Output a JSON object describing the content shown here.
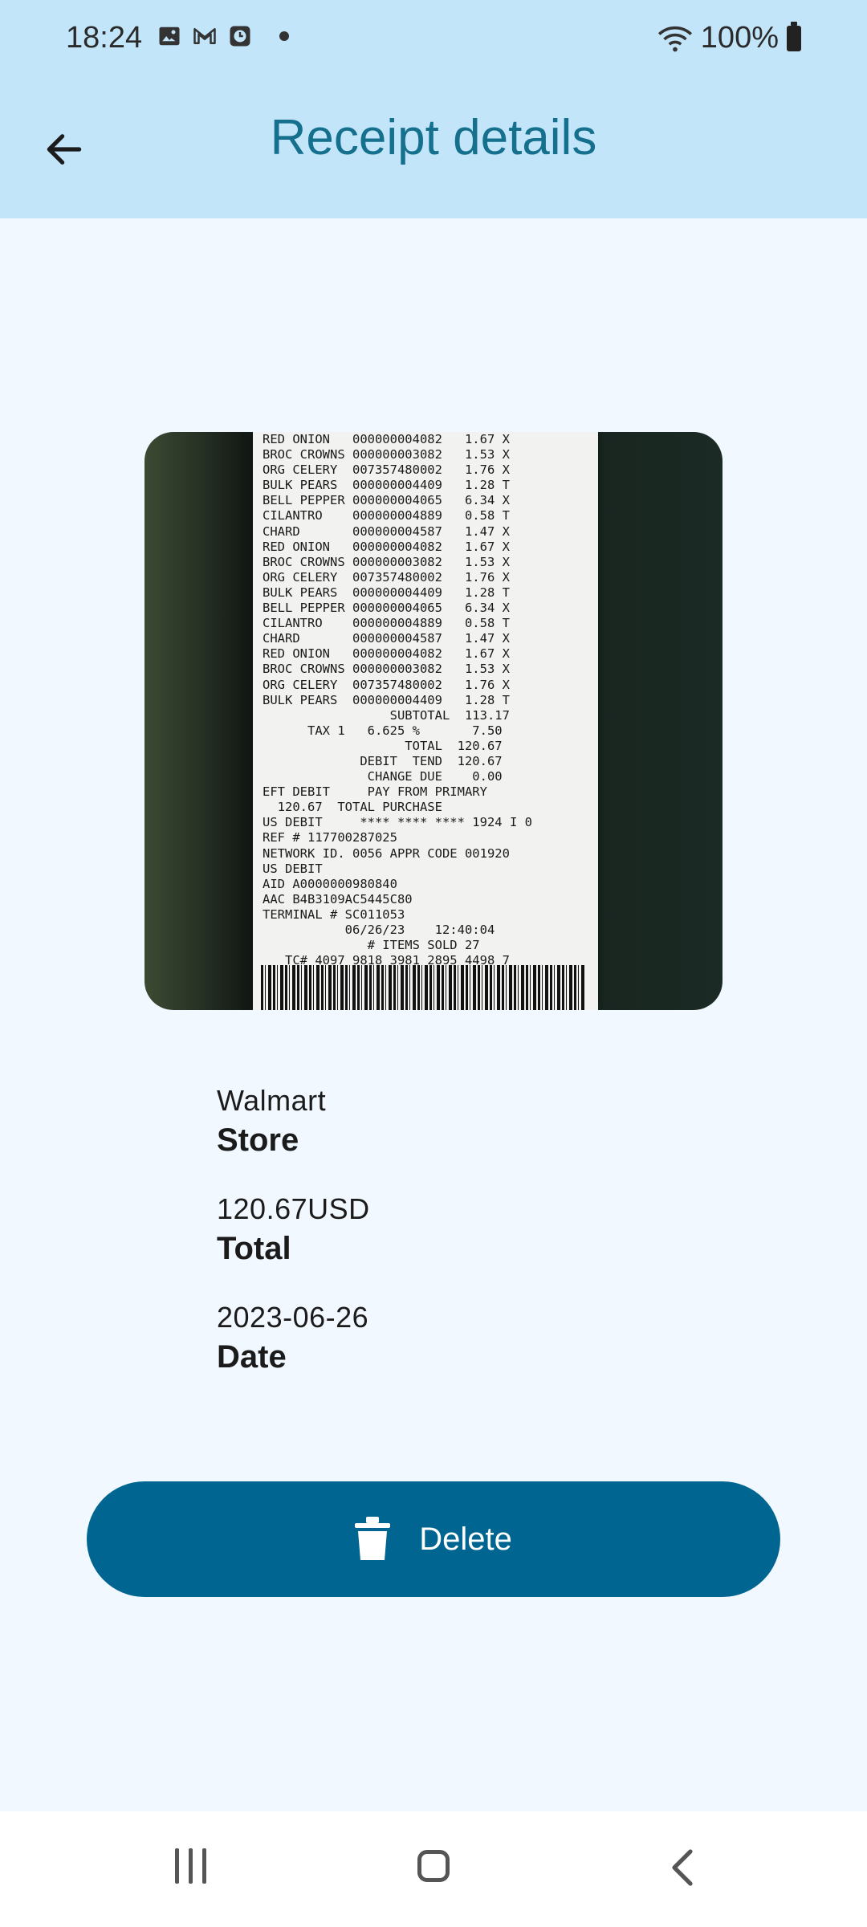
{
  "status_bar": {
    "time": "18:24",
    "battery": "100%",
    "icons": [
      "image-icon",
      "gmail-icon",
      "clock-app-icon",
      "notification-dot",
      "wifi-icon",
      "battery-icon"
    ]
  },
  "header": {
    "title": "Receipt details",
    "back_icon": "arrow-left-icon"
  },
  "receipt_image": {
    "lines": [
      "RED ONION   000000004082   1.67 X",
      "BROC CROWNS 000000003082   1.53 X",
      "ORG CELERY  007357480002   1.76 X",
      "BULK PEARS  000000004409   1.28 T",
      "BELL PEPPER 000000004065   6.34 X",
      "CILANTRO    000000004889   0.58 T",
      "CHARD       000000004587   1.47 X",
      "RED ONION   000000004082   1.67 X",
      "BROC CROWNS 000000003082   1.53 X",
      "ORG CELERY  007357480002   1.76 X",
      "BULK PEARS  000000004409   1.28 T",
      "BELL PEPPER 000000004065   6.34 X",
      "CILANTRO    000000004889   0.58 T",
      "CHARD       000000004587   1.47 X",
      "RED ONION   000000004082   1.67 X",
      "BROC CROWNS 000000003082   1.53 X",
      "ORG CELERY  007357480002   1.76 X",
      "BULK PEARS  000000004409   1.28 T",
      "                 SUBTOTAL  113.17",
      "      TAX 1   6.625 %       7.50",
      "                   TOTAL  120.67",
      "             DEBIT  TEND  120.67",
      "              CHANGE DUE    0.00",
      "EFT DEBIT     PAY FROM PRIMARY",
      "  120.67  TOTAL PURCHASE",
      "US DEBIT     **** **** **** 1924 I 0",
      "REF # 117700287025",
      "NETWORK ID. 0056 APPR CODE 001920",
      "US DEBIT",
      "AID A0000000980840",
      "AAC B4B3109AC5445C80",
      "TERMINAL # SC011053",
      "           06/26/23    12:40:04",
      "              # ITEMS SOLD 27",
      "   TC# 4097 9818 3981 2895 4498 7"
    ]
  },
  "fields": [
    {
      "value": "Walmart",
      "label": "Store"
    },
    {
      "value": "120.67USD",
      "label": "Total"
    },
    {
      "value": "2023-06-26",
      "label": "Date"
    }
  ],
  "delete_button": {
    "label": "Delete",
    "icon": "trash-icon",
    "color": "#006590"
  },
  "nav_bar": {
    "icons": [
      "recent-apps-icon",
      "home-icon",
      "back-icon"
    ]
  },
  "colors": {
    "app_bar": "#c2e5fa",
    "title": "#15708d",
    "background": "#f1f8ff"
  }
}
